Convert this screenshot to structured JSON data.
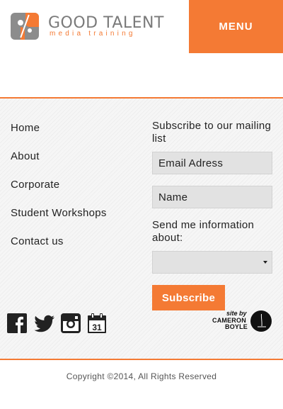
{
  "header": {
    "brand_name": "GOOD TALENT",
    "brand_sub": "media training",
    "menu_label": "MENU"
  },
  "nav": {
    "items": [
      {
        "label": "Home"
      },
      {
        "label": "About"
      },
      {
        "label": "Corporate"
      },
      {
        "label": "Student Workshops"
      },
      {
        "label": "Contact us"
      }
    ]
  },
  "subscribe": {
    "title": "Subscribe to our mailing list",
    "email_placeholder": "Email Adress",
    "name_placeholder": "Name",
    "send_label": "Send me information about:",
    "select_value": "",
    "button_label": "Subscribe"
  },
  "social": {
    "icons": [
      "facebook-icon",
      "twitter-icon",
      "instagram-icon",
      "calendar-icon"
    ],
    "calendar_day": "31"
  },
  "credit": {
    "small": "site by",
    "name_line1": "CAMERON",
    "name_line2": "BOYLE"
  },
  "copyright": "Copyright ©2014, All Rights Reserved",
  "colors": {
    "accent": "#f47a34",
    "logo_gray": "#8c8c8c",
    "field_bg": "#e2e2e2"
  }
}
